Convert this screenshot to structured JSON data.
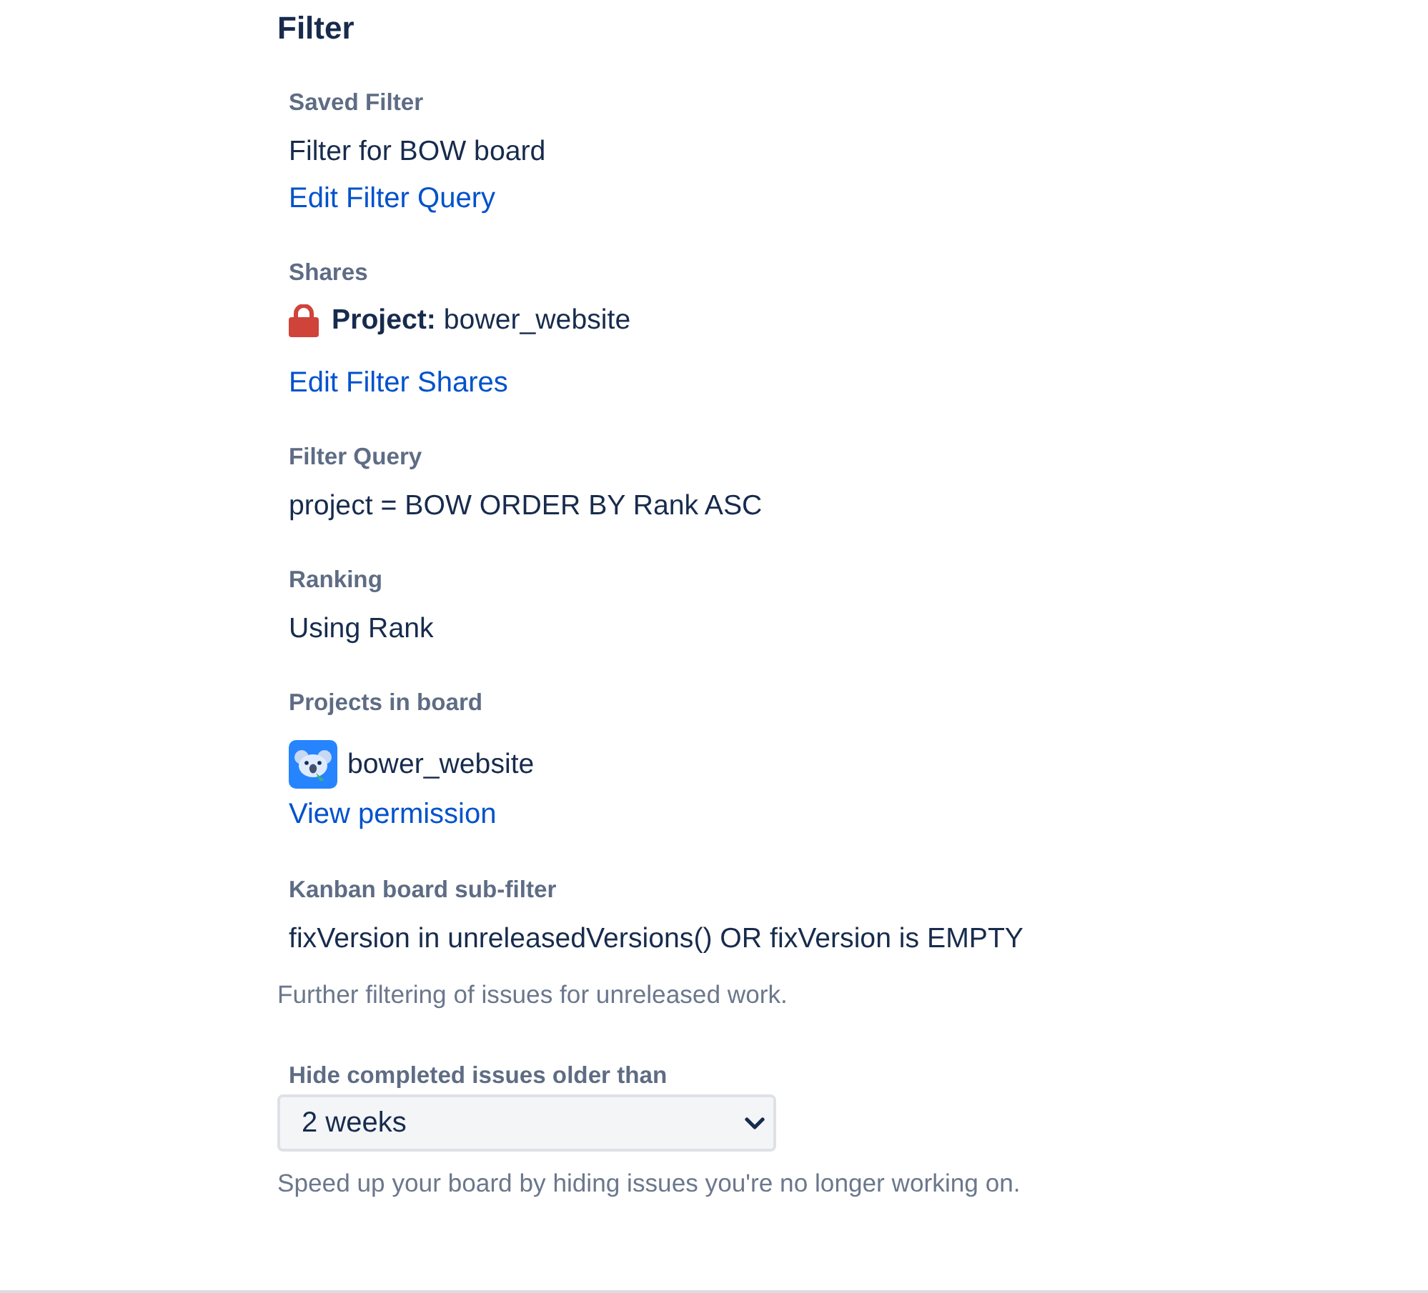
{
  "heading": "Filter",
  "sections": [
    {
      "kind": "text",
      "label": "Saved Filter",
      "value": "Filter for BOW board",
      "link": "Edit Filter Query"
    },
    {
      "kind": "share",
      "label": "Shares",
      "value": "**Project:** bower_website",
      "link": "Edit Filter Shares"
    },
    {
      "kind": "text",
      "label": "Filter Query",
      "value": "project = BOW ORDER BY Rank ASC"
    },
    {
      "kind": "text",
      "label": "Ranking",
      "value": "Using Rank"
    },
    {
      "kind": "project",
      "label": "Projects in board",
      "value": "bower_website",
      "link": "View permission"
    },
    {
      "kind": "text",
      "label": "Kanban board sub-filter",
      "value": "fixVersion in unreleasedVersions() OR fixVersion is EMPTY",
      "help": "Further filtering of issues for unreleased work."
    },
    {
      "kind": "select",
      "label": "Hide completed issues older than",
      "value": "2 weeks",
      "help": "Speed up your board by hiding issues you're no longer working on."
    }
  ]
}
